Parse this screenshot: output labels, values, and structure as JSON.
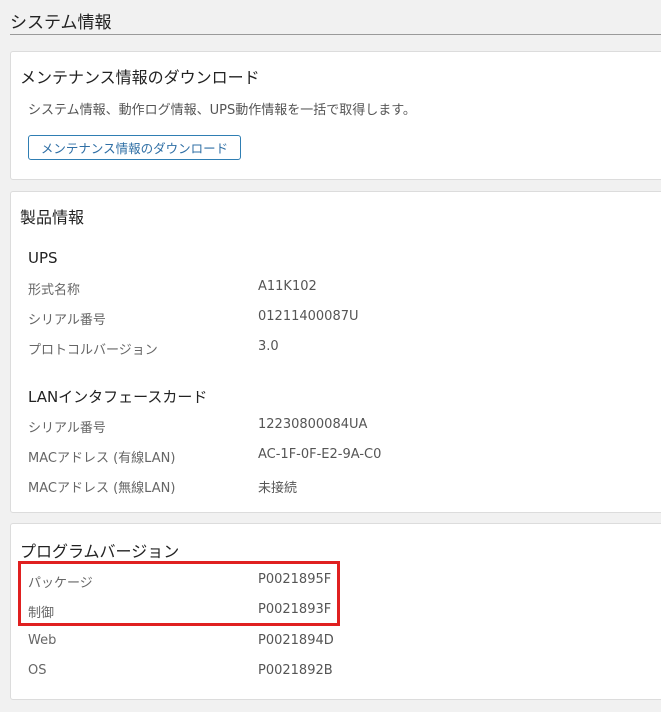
{
  "page": {
    "title": "システム情報"
  },
  "maintenance": {
    "title": "メンテナンス情報のダウンロード",
    "description": "システム情報、動作ログ情報、UPS動作情報を一括で取得します。",
    "button_label": "メンテナンス情報のダウンロード"
  },
  "product": {
    "title": "製品情報",
    "ups": {
      "title": "UPS",
      "rows": [
        {
          "label": "形式名称",
          "value": "A11K102"
        },
        {
          "label": "シリアル番号",
          "value": "01211400087U"
        },
        {
          "label": "プロトコルバージョン",
          "value": "3.0"
        }
      ]
    },
    "lan": {
      "title": "LANインタフェースカード",
      "rows": [
        {
          "label": "シリアル番号",
          "value": "12230800084UA"
        },
        {
          "label": "MACアドレス (有線LAN)",
          "value": "AC-1F-0F-E2-9A-C0"
        },
        {
          "label": "MACアドレス (無線LAN)",
          "value": "未接続"
        }
      ]
    }
  },
  "program": {
    "title": "プログラムバージョン",
    "rows": [
      {
        "label": "パッケージ",
        "value": "P0021895F"
      },
      {
        "label": "制御",
        "value": "P0021893F"
      },
      {
        "label": "Web",
        "value": "P0021894D"
      },
      {
        "label": "OS",
        "value": "P0021892B"
      }
    ]
  },
  "colors": {
    "highlight": "#e02020",
    "button_border": "#2f7eb3"
  }
}
